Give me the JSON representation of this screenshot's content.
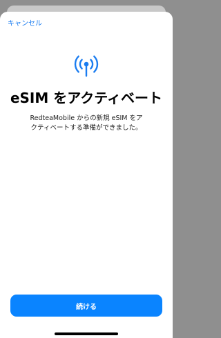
{
  "header": {
    "cancel_label": "キャンセル"
  },
  "main": {
    "icon": "antenna-radiowaves-icon",
    "title": "eSIM をアクティベート",
    "description_lines": [
      "RedteaMobile からの新規 eSIM をア",
      "クティベートする準備ができました。"
    ]
  },
  "footer": {
    "continue_label": "続ける"
  },
  "colors": {
    "accent": "#0a84ff",
    "link": "#1a7cf0",
    "backdrop": "#8f8f8f"
  }
}
